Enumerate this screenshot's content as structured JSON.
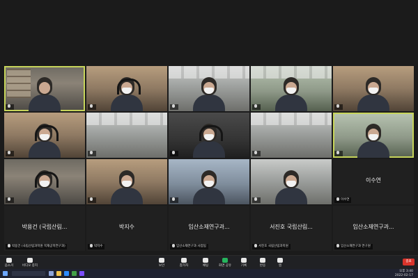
{
  "participants": [
    {
      "name": "",
      "row": 0,
      "col": 0
    },
    {
      "name": "",
      "row": 0,
      "col": 1
    },
    {
      "name": "",
      "row": 0,
      "col": 2
    },
    {
      "name": "",
      "row": 0,
      "col": 3
    },
    {
      "name": "",
      "row": 0,
      "col": 4
    },
    {
      "name": "",
      "row": 1,
      "col": 0
    },
    {
      "name": "",
      "row": 1,
      "col": 1
    },
    {
      "name": "",
      "row": 1,
      "col": 2
    },
    {
      "name": "",
      "row": 1,
      "col": 3
    },
    {
      "name": "",
      "row": 1,
      "col": 4
    },
    {
      "name": "",
      "row": 2,
      "col": 0
    },
    {
      "name": "",
      "row": 2,
      "col": 1
    },
    {
      "name": "",
      "row": 2,
      "col": 2
    },
    {
      "name": "",
      "row": 2,
      "col": 3
    },
    {
      "name": "이수연",
      "row": 2,
      "col": 4
    }
  ],
  "name_tiles": [
    {
      "display_name": "박용건 (국립산림...",
      "badge": "박용건 (국립산림과학원 목재공학연구과)"
    },
    {
      "display_name": "박지수",
      "badge": "박지수"
    },
    {
      "display_name": "임산소재연구과...",
      "badge": "임산소재연구과 사업팀"
    },
    {
      "display_name": "서진호 국립산림...",
      "badge": "서진호 국립산림과학원"
    },
    {
      "display_name": "임산소재연구과...",
      "badge": "임산소재연구과 연구원"
    }
  ],
  "controls": {
    "left": [
      "음소거",
      "비디오 중지"
    ],
    "center": [
      "보안",
      "참가자",
      "채팅",
      "화면 공유",
      "기록",
      "반응",
      "앱"
    ],
    "end_label": "종료"
  },
  "taskbar": {
    "time": "오후 3:40",
    "date": "2022-02-17"
  }
}
